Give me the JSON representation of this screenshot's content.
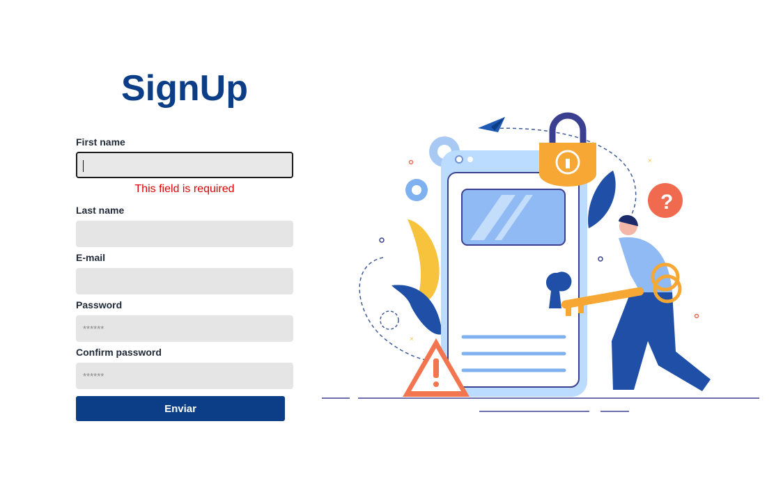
{
  "form": {
    "title": "SignUp",
    "first_name": {
      "label": "First name",
      "value": "",
      "error": "This field is required"
    },
    "last_name": {
      "label": "Last name",
      "value": ""
    },
    "email": {
      "label": "E-mail",
      "value": ""
    },
    "password": {
      "label": "Password",
      "placeholder": "******"
    },
    "confirm_password": {
      "label": "Confirm password",
      "placeholder": "******"
    },
    "submit_label": "Enviar"
  },
  "colors": {
    "brand": "#0b3e86",
    "error": "#e00000",
    "input_bg": "#e5e5e5"
  },
  "illustration": {
    "icons": [
      "paper-plane-icon",
      "padlock-icon",
      "gear-icon",
      "question-bubble-icon",
      "warning-triangle-icon",
      "key-icon",
      "person-icon",
      "phone-icon"
    ]
  }
}
